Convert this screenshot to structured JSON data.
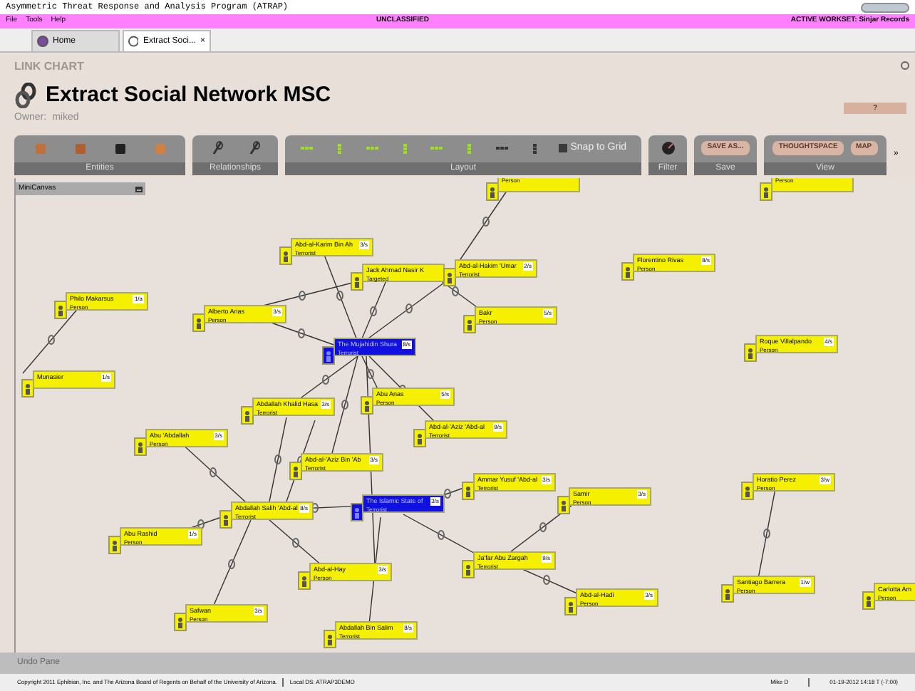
{
  "window": {
    "title": "Asymmetric Threat Response and Analysis Program (ATRAP)"
  },
  "menu": {
    "items": [
      "File",
      "Tools",
      "Help"
    ],
    "classification": "UNCLASSIFIED",
    "workset": "ACTIVE WORKSET: Sinjar Records"
  },
  "tabs": [
    {
      "label": "Home",
      "selected": false
    },
    {
      "label": "Extract Soci...",
      "selected": true,
      "close": "×"
    }
  ],
  "header": {
    "section": "LINK CHART",
    "title": "Extract Social Network MSC",
    "owner_label": "Owner:",
    "owner": "miked",
    "help": "?"
  },
  "toolbar": [
    {
      "label": "Entities",
      "kind": "entities"
    },
    {
      "label": "Relationships",
      "kind": "relationships"
    },
    {
      "label": "Layout",
      "kind": "layout",
      "snap_label": "Snap to Grid",
      "snap_checked": false
    },
    {
      "label": "Filter",
      "kind": "filter"
    },
    {
      "label": "Save",
      "kind": "save",
      "buttons": [
        "SAVE AS..."
      ]
    },
    {
      "label": "View",
      "kind": "view",
      "buttons": [
        "THOUGHTSPACE",
        "MAP"
      ]
    }
  ],
  "toolbar_more": "»",
  "minicanvas": {
    "title": "MiniCanvas"
  },
  "nodes": [
    {
      "type": "Person",
      "kind": "person"
    },
    {
      "type": "Person",
      "kind": "person"
    },
    {
      "name": "Abd-al-Karim Bin Ah",
      "type": "Terrorist",
      "count": "3/s",
      "kind": "person"
    },
    {
      "name": "Jack Ahmad Nasir K",
      "type": "Targeted",
      "kind": "person"
    },
    {
      "name": "Abd-al-Hakim 'Umar",
      "type": "Terrorist",
      "count": "2/s",
      "kind": "person"
    },
    {
      "name": "Florentino Rivas",
      "type": "Person",
      "count": "8/s",
      "kind": "person"
    },
    {
      "name": "Philo Makarsus",
      "type": "Person",
      "count": "1/a",
      "kind": "person"
    },
    {
      "name": "Alberto Arias",
      "type": "Person",
      "count": "3/s",
      "kind": "person"
    },
    {
      "name": "Bakr",
      "type": "Person",
      "count": "5/s",
      "kind": "person"
    },
    {
      "name": "The Mujahidin Shura",
      "type": "Terrorist",
      "count": "8/s",
      "kind": "group"
    },
    {
      "name": "Roque Villalpando",
      "type": "Person",
      "count": "4/s",
      "kind": "person"
    },
    {
      "name": "Munasier",
      "count": "1/s",
      "kind": "person"
    },
    {
      "name": "Abu Anas",
      "type": "Person",
      "count": "5/s",
      "kind": "person"
    },
    {
      "name": "Abdallah Khalid Hasa",
      "type": "Terrorist",
      "count": "3/s",
      "kind": "person"
    },
    {
      "name": "Abd-al-'Aziz 'Abd-al",
      "type": "Terrorist",
      "count": "9/s",
      "kind": "person"
    },
    {
      "name": "Abu 'Abdallah",
      "type": "Person",
      "count": "3/s",
      "kind": "person"
    },
    {
      "name": "Abd-al-'Aziz Bin 'Ab",
      "type": "Terrorist",
      "count": "3/s",
      "kind": "person"
    },
    {
      "name": "Ammar Yusuf 'Abd-al",
      "type": "Terrorist",
      "count": "3/s",
      "kind": "person"
    },
    {
      "name": "Horatio Perez",
      "type": "Person",
      "count": "3/w",
      "kind": "person"
    },
    {
      "name": "Samir",
      "type": "Person",
      "count": "3/s",
      "kind": "person"
    },
    {
      "name": "Abdallah Salih 'Abd-al",
      "type": "Terrorist",
      "count": "8/s",
      "kind": "person"
    },
    {
      "name": "The Islamic State of",
      "type": "Terrorist",
      "count": "3/s",
      "kind": "group"
    },
    {
      "name": "Abu Rashid",
      "type": "Person",
      "count": "1/s",
      "kind": "person"
    },
    {
      "name": "Ja'far Abu Zargah",
      "type": "Terrorist",
      "count": "9/s",
      "kind": "person"
    },
    {
      "name": "Abd-al-Hay",
      "type": "Person",
      "count": "3/s",
      "kind": "person"
    },
    {
      "name": "Abd-al-Hadi",
      "type": "Person",
      "count": "3/s",
      "kind": "person"
    },
    {
      "name": "Santiago Barrera",
      "type": "Person",
      "count": "1/w",
      "kind": "person"
    },
    {
      "name": "Carlotta Am",
      "type": "Person",
      "kind": "person"
    },
    {
      "name": "Safwan",
      "type": "Person",
      "count": "3/s",
      "kind": "person"
    },
    {
      "name": "Abdallah Bin Salim",
      "type": "Terrorist",
      "count": "8/s",
      "kind": "person"
    }
  ],
  "undo_pane": {
    "title": "Undo Pane"
  },
  "status_bar": {
    "copyright": "Copyright 2011 Ephibian, Inc. and The Arizona Board of Regents on Behalf of the University of Arizona.",
    "datasource": "Local DS: ATRAP3DEMO",
    "user": "Mike D",
    "datetime": "01-19-2012 14:18 T (-7:00)"
  }
}
